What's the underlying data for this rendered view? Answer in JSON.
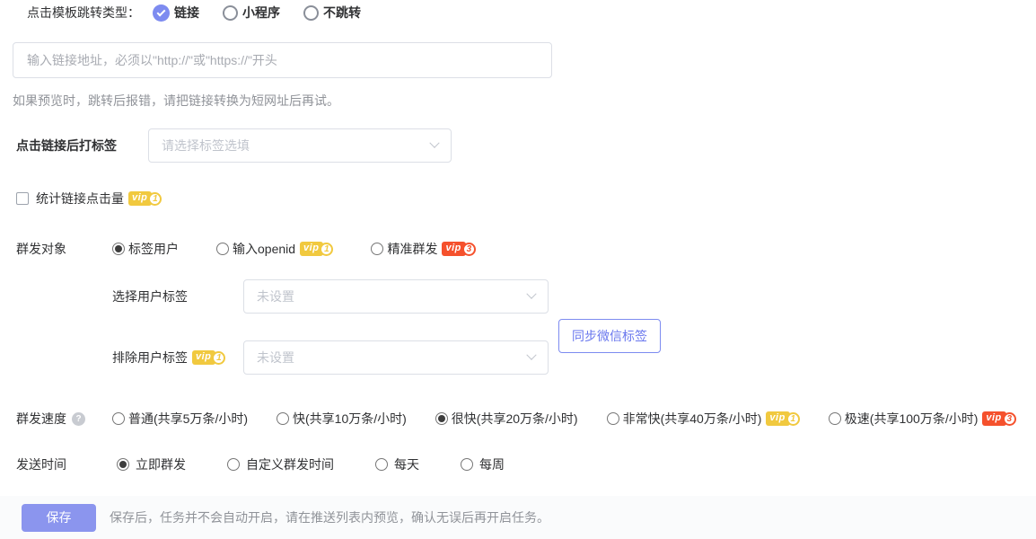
{
  "jump_type": {
    "label": "点击模板跳转类型：",
    "options": [
      {
        "label": "链接",
        "selected": true
      },
      {
        "label": "小程序",
        "selected": false
      },
      {
        "label": "不跳转",
        "selected": false
      }
    ]
  },
  "url_input": {
    "placeholder": "输入链接地址，必须以\"http://\"或\"https://\"开头",
    "value": ""
  },
  "url_hint": "如果预览时，跳转后报错，请把链接转换为短网址后再试。",
  "tag_after_click": {
    "label": "点击链接后打标签",
    "placeholder": "请选择标签选填"
  },
  "track_clicks": {
    "label": "统计链接点击量",
    "checked": false,
    "vip_level": "1"
  },
  "audience": {
    "label": "群发对象",
    "options": [
      {
        "label": "标签用户",
        "selected": true
      },
      {
        "label": "输入openid",
        "selected": false,
        "vip_level": "1"
      },
      {
        "label": "精准群发",
        "selected": false,
        "vip_level": "3"
      }
    ]
  },
  "select_user_tag": {
    "label": "选择用户标签",
    "placeholder": "未设置"
  },
  "sync_button_label": "同步微信标签",
  "exclude_user_tag": {
    "label": "排除用户标签",
    "vip_level": "1",
    "placeholder": "未设置"
  },
  "send_speed": {
    "label": "群发速度",
    "help_icon": "?",
    "options": [
      {
        "label": "普通(共享5万条/小时)",
        "selected": false
      },
      {
        "label": "快(共享10万条/小时)",
        "selected": false
      },
      {
        "label": "很快(共享20万条/小时)",
        "selected": true
      },
      {
        "label": "非常快(共享40万条/小时)",
        "selected": false,
        "vip_level": "1"
      },
      {
        "label": "极速(共享100万条/小时)",
        "selected": false,
        "vip_level": "3"
      }
    ]
  },
  "send_time": {
    "label": "发送时间",
    "options": [
      {
        "label": "立即群发",
        "selected": true
      },
      {
        "label": "自定义群发时间",
        "selected": false
      },
      {
        "label": "每天",
        "selected": false
      },
      {
        "label": "每周",
        "selected": false
      }
    ]
  },
  "footer": {
    "save_button": "保存",
    "note": "保存后，任务并不会自动开启，请在推送列表内预览，确认无误后再开启任务。"
  },
  "vip_badge_text": "vip",
  "colors": {
    "primary": "#7d8bf0",
    "save_button": "#8b95ee",
    "vip_yellow": "#f1c93f",
    "vip_red": "#f5512d",
    "placeholder": "#c0c4cc",
    "hint": "#909399",
    "border": "#dcdfe6"
  }
}
